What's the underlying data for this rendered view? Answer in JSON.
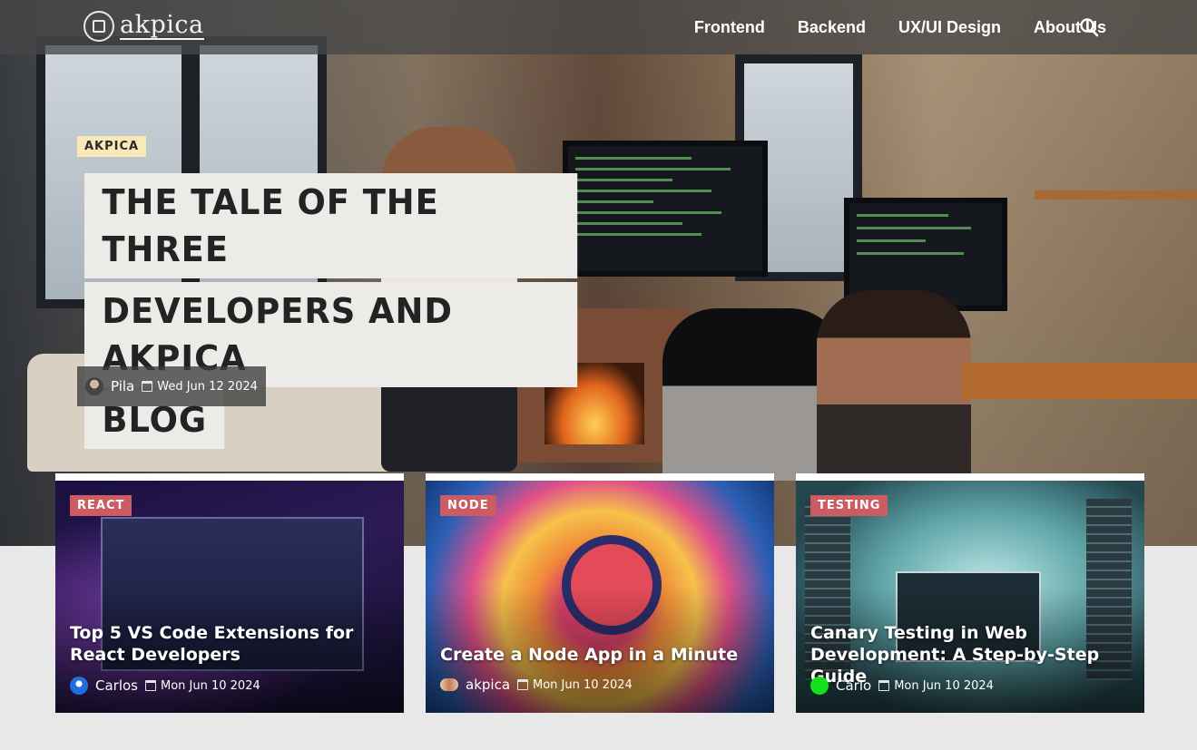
{
  "brand": {
    "name": "akpica"
  },
  "nav": {
    "items": [
      {
        "label": "Frontend"
      },
      {
        "label": "Backend"
      },
      {
        "label": "UX/UI Design"
      },
      {
        "label": "About Us"
      }
    ],
    "search_icon": "search-icon"
  },
  "hero": {
    "category": "AKPICA",
    "title_lines": [
      "THE TALE OF THE THREE",
      "DEVELOPERS AND AKPICA",
      "BLOG"
    ],
    "author": "Pila",
    "date": "Wed Jun 12 2024"
  },
  "cards": [
    {
      "category": "REACT",
      "title": "Top 5 VS Code Extensions for React Developers",
      "author": "Carlos",
      "date": "Mon Jun 10 2024"
    },
    {
      "category": "NODE",
      "title": "Create a Node App in a Minute",
      "author": "akpica",
      "date": "Mon Jun 10 2024"
    },
    {
      "category": "TESTING",
      "title": "Canary Testing in Web Development: A Step-by-Step Guide",
      "author": "Carlo",
      "date": "Mon Jun 10 2024"
    }
  ],
  "colors": {
    "header_bg": "#464646",
    "hero_category_bg": "#f9e9b8",
    "card_category_bg": "#cc5b62",
    "page_bg": "#e8e8e8"
  }
}
